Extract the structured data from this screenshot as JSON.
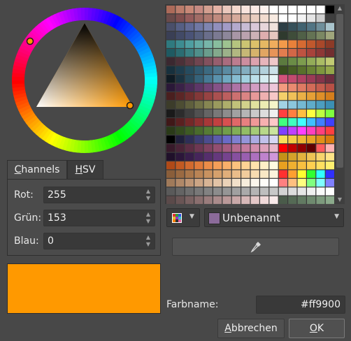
{
  "tabs": [
    {
      "label": "Channels",
      "mnemonic": "C",
      "rest": "hannels"
    },
    {
      "label": "HSV",
      "mnemonic": "H",
      "rest": "SV"
    }
  ],
  "channels": [
    {
      "label": "Rot:",
      "value": "255"
    },
    {
      "label": "Grün:",
      "value": "153"
    },
    {
      "label": "Blau:",
      "value": "0"
    }
  ],
  "current_color": "#ff9900",
  "palette": {
    "selected_name": "Unbenannt",
    "selected_swatch": "#8b6b9a"
  },
  "color_name": {
    "label": "Farbname:",
    "value": "#ff9900"
  },
  "buttons": {
    "cancel": {
      "label": "Abbrechen",
      "mnemonic": "A",
      "rest": "bbrechen"
    },
    "ok": {
      "label": "OK",
      "mnemonic": "O",
      "rest": "K"
    }
  },
  "palette_colors": [
    [
      "#ac6a59",
      "#bb7c6b",
      "#c88877",
      "#c68a82",
      "#d39f90",
      "#e4b2a5",
      "#eac8bd",
      "#f4d8cd",
      "#f8e4dd",
      "#fbeae5",
      "#fdf2ee",
      "#ffffff",
      "#ffffff",
      "#ffffff",
      "#ffffff",
      "#ffffff",
      "#ffffff",
      "#000000"
    ],
    [
      "#6a4a4a",
      "#804e4e",
      "#955c5c",
      "#a26c66",
      "#b07a70",
      "#c08a7e",
      "#cb9a8c",
      "#d6aa9b",
      "#e0bcab",
      "#e9cdbf",
      "#f2dccf",
      "#f8ebe2",
      "#ffffff",
      "#fdfdfd",
      "#f3f3f3",
      "#e5e5e5",
      "#cfcfcf",
      "#3f3f3f"
    ],
    [
      "#4a4f6a",
      "#565f84",
      "#626a95",
      "#7078a4",
      "#7f85b1",
      "#918fbd",
      "#a29bc6",
      "#b4aacd",
      "#c8bcd5",
      "#dac8d8",
      "#e7d6da",
      "#f0e2dc",
      "#2d3f46",
      "#36515a",
      "#416370",
      "#527584",
      "#6f8f9b",
      "#a9c4cc"
    ],
    [
      "#3a3f55",
      "#424a67",
      "#4a5377",
      "#56607f",
      "#6a6e8b",
      "#7b7a92",
      "#8d879b",
      "#a896a6",
      "#baa2ae",
      "#ccb2b6",
      "#deaeae",
      "#e6c7bf",
      "#2f3a2e",
      "#3f4d3a",
      "#506047",
      "#647354",
      "#7b8863",
      "#a0a67c"
    ],
    [
      "#2f7a7f",
      "#3d8c91",
      "#4e9ea1",
      "#62aaa7",
      "#77b5a9",
      "#88bd9e",
      "#9ec390",
      "#b5c47f",
      "#cbc472",
      "#dcc06a",
      "#e6b863",
      "#f0ad5d",
      "#f39a4a",
      "#e9803a",
      "#d66a32",
      "#c0582d",
      "#a9482a",
      "#8c3a27"
    ],
    [
      "#1f5a62",
      "#2b6c72",
      "#3a8083",
      "#508f8b",
      "#6a9d8d",
      "#83a98c",
      "#9cb28a",
      "#b1b781",
      "#c6b876",
      "#d6b36c",
      "#e1a662",
      "#e79458",
      "#e37d4f",
      "#d36747",
      "#bf5341",
      "#a8433b",
      "#8e3836",
      "#722e30"
    ],
    [
      "#3b2830",
      "#4c3038",
      "#5e3a42",
      "#704550",
      "#83515e",
      "#975e6e",
      "#aa6c7f",
      "#bc7c8f",
      "#cd8e9f",
      "#dda2ae",
      "#e7b5bb",
      "#efc8c9",
      "#5c7a3f",
      "#6b8c46",
      "#7d9c4e",
      "#93ac58",
      "#aabc64",
      "#c2cb73"
    ],
    [
      "#17303d",
      "#1e3d4e",
      "#264b5f",
      "#305a70",
      "#3c6a81",
      "#4a7a92",
      "#5b8ba2",
      "#6e9cb2",
      "#84aec0",
      "#9bc0ce",
      "#b3d1dc",
      "#cbe1e8",
      "#3a4d1e",
      "#485e24",
      "#58702b",
      "#6a8334",
      "#7e963e",
      "#95a84a"
    ],
    [
      "#0f1b24",
      "#1b3240",
      "#274a5c",
      "#35627a",
      "#467a96",
      "#5a92ad",
      "#6fa9c1",
      "#87bdd1",
      "#a1d0df",
      "#bcdfe9",
      "#d4ebf0",
      "#e8f4f6",
      "#d2527a",
      "#c24a6e",
      "#b04262",
      "#9b3b56",
      "#85344a",
      "#6e2e3f"
    ],
    [
      "#2a1838",
      "#3a2148",
      "#4b2b58",
      "#5d3668",
      "#704378",
      "#855288",
      "#9a6297",
      "#ae74a6",
      "#c188b5",
      "#d29dc3",
      "#e1b2cf",
      "#eec7da",
      "#f39a7f",
      "#ea8a70",
      "#df7a63",
      "#d36b58",
      "#c65d4e",
      "#b85045"
    ],
    [
      "#4a1f1f",
      "#5c2626",
      "#6f2e2e",
      "#833838",
      "#974343",
      "#aa5050",
      "#bc5f5f",
      "#cc7070",
      "#da8484",
      "#e69999",
      "#efb0b0",
      "#f6c7c7",
      "#f4cf6a",
      "#f0c058",
      "#ebb046",
      "#e6a036",
      "#df8f28",
      "#d57e1c"
    ],
    [
      "#3c3c2a",
      "#4d4d33",
      "#5f5f3d",
      "#727247",
      "#868652",
      "#9a9a5e",
      "#aeae6b",
      "#c1c17a",
      "#d2d28b",
      "#e1e19e",
      "#ececb3",
      "#f5f5c9",
      "#a2d2e4",
      "#8bc6dc",
      "#74b9d3",
      "#5facca",
      "#4c9ec0",
      "#3b8fb4"
    ],
    [
      "#1a1a1a",
      "#2c2c2c",
      "#3e3e3e",
      "#515151",
      "#656565",
      "#797979",
      "#8d8d8d",
      "#a1a1a1",
      "#b5b5b5",
      "#c9c9c9",
      "#dcdcdc",
      "#efefef",
      "#ff4040",
      "#ff7f40",
      "#ffbf40",
      "#ffff40",
      "#bfff40",
      "#7fff40"
    ],
    [
      "#401818",
      "#5a2020",
      "#742828",
      "#8e3030",
      "#a83838",
      "#c24040",
      "#d85050",
      "#e06868",
      "#e88080",
      "#f09898",
      "#f7b0b0",
      "#ffc8c8",
      "#40ff7f",
      "#40ffbf",
      "#40ffff",
      "#40bfff",
      "#407fff",
      "#4040ff"
    ],
    [
      "#2a3a18",
      "#344a1e",
      "#3e5a24",
      "#4a6b2c",
      "#577c35",
      "#648d3f",
      "#729e4a",
      "#82ae57",
      "#93bd66",
      "#a5cb77",
      "#b8d88a",
      "#cbe49f",
      "#7f40ff",
      "#bf40ff",
      "#ff40ff",
      "#ff40bf",
      "#ff407f",
      "#ff4040"
    ],
    [
      "#000000",
      "#1f1f3a",
      "#2e2e56",
      "#3d3d72",
      "#4c4c8e",
      "#5b5baa",
      "#6a6ac6",
      "#7f7fd0",
      "#9595d9",
      "#ababe2",
      "#c1c1eb",
      "#d7d7f4",
      "#f8e05a",
      "#f3cc47",
      "#eeb835",
      "#e8a426",
      "#e19019",
      "#d97c0f"
    ],
    [
      "#381a2a",
      "#4a2337",
      "#5c2d45",
      "#6e3753",
      "#804262",
      "#924e71",
      "#a45b80",
      "#b56a8f",
      "#c47b9e",
      "#d28ead",
      "#dea2bc",
      "#e9b7cb",
      "#ff0000",
      "#c00000",
      "#900000",
      "#600000",
      "#ff5c5c",
      "#ffb3b3"
    ],
    [
      "#20102a",
      "#2c163a",
      "#381d4a",
      "#46255b",
      "#552e6c",
      "#65387d",
      "#76438e",
      "#87509f",
      "#9a5fb0",
      "#ad70bf",
      "#bf83cd",
      "#d097da",
      "#c49218",
      "#d4a22a",
      "#e2b33e",
      "#eec454",
      "#f7d46c",
      "#fee487"
    ],
    [
      "#b04a18",
      "#c25a22",
      "#d26a2e",
      "#e07a3a",
      "#ec8c48",
      "#f49e58",
      "#f9b06a",
      "#fcc27e",
      "#fed394",
      "#ffe3ac",
      "#fff0c6",
      "#fffbe1",
      "#e8a020",
      "#f0b030",
      "#f8c040",
      "#ffd050",
      "#ffe060",
      "#fff070"
    ],
    [
      "#8a5e3a",
      "#9a6a42",
      "#aa774b",
      "#ba8455",
      "#c89260",
      "#d5a06c",
      "#e0ae7a",
      "#eabd8a",
      "#f1cc9c",
      "#f6dbb0",
      "#f9e8c5",
      "#fcf3dc",
      "#ff3030",
      "#ffa030",
      "#ffff30",
      "#30ff30",
      "#30ffff",
      "#3030ff"
    ],
    [
      "#a07a5a",
      "#b08868",
      "#bf9676",
      "#cca585",
      "#d8b495",
      "#e2c3a6",
      "#ebd2b8",
      "#f2e0ca",
      "#f7eddc",
      "#fbf6ec",
      "#fefcf8",
      "#ffffff",
      "#ff8080",
      "#ffc080",
      "#ffff80",
      "#80ff80",
      "#80ffff",
      "#8080ff"
    ],
    [
      "#5a5a5a",
      "#646464",
      "#6e6e6e",
      "#787878",
      "#828282",
      "#8c8c8c",
      "#969696",
      "#a0a0a0",
      "#aaaaaa",
      "#b4b4b4",
      "#bebebe",
      "#c8c8c8",
      "#d2d2d2",
      "#dcdcdc",
      "#e6e6e6",
      "#f0f0f0",
      "#fafafa",
      "#ffffff"
    ],
    [
      "#5b4a4a",
      "#6a5555",
      "#7a6262",
      "#8a6f6f",
      "#9a7d7d",
      "#aa8b8b",
      "#ba9999",
      "#c9a8a8",
      "#d7b8b8",
      "#e4c8c8",
      "#f0d9d9",
      "#f9eaea",
      "#4a5b4a",
      "#556a55",
      "#627a62",
      "#6f8a6f",
      "#7d9a7d",
      "#8baa8b"
    ]
  ]
}
